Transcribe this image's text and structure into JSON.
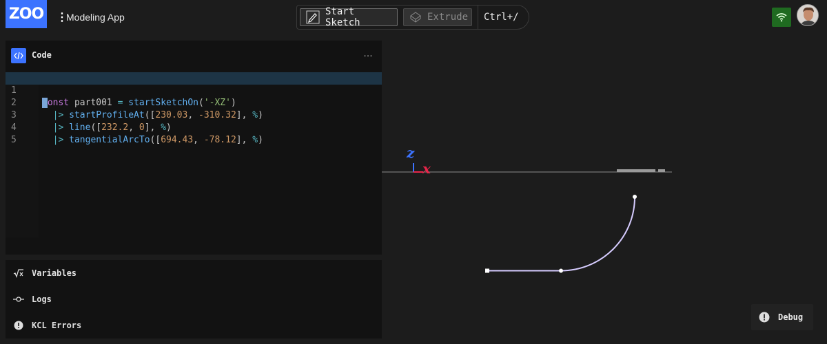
{
  "header": {
    "logo_text": "ZOO",
    "app_title": "Modeling App",
    "toolbar": {
      "start_sketch_label": "Start Sketch",
      "extrude_label": "Extrude",
      "shortcut_hint": "Ctrl+/"
    }
  },
  "code_pane": {
    "title": "Code",
    "more_label": "…",
    "line_numbers": [
      "1",
      "2",
      "3",
      "4",
      "5"
    ],
    "lines": [
      "const part001 = startSketchOn('-XZ')",
      "  |> startProfileAt([230.03, -310.32], %)",
      "  |> line([232.2, 0], %)",
      "  |> tangentialArcTo([694.43, -78.12], %)",
      ""
    ]
  },
  "bottom_panels": {
    "variables_label": "Variables",
    "logs_label": "Logs",
    "kcl_errors_label": "KCL Errors"
  },
  "viewport": {
    "axis_z_label": "z",
    "axis_x_label": "x",
    "debug_label": "Debug"
  },
  "colors": {
    "brand": "#3c73ff",
    "network_ok": "#1f6a20",
    "sketch_line": "#d6ccff",
    "axis_z": "#3c73ff",
    "axis_x": "#e8254a"
  }
}
